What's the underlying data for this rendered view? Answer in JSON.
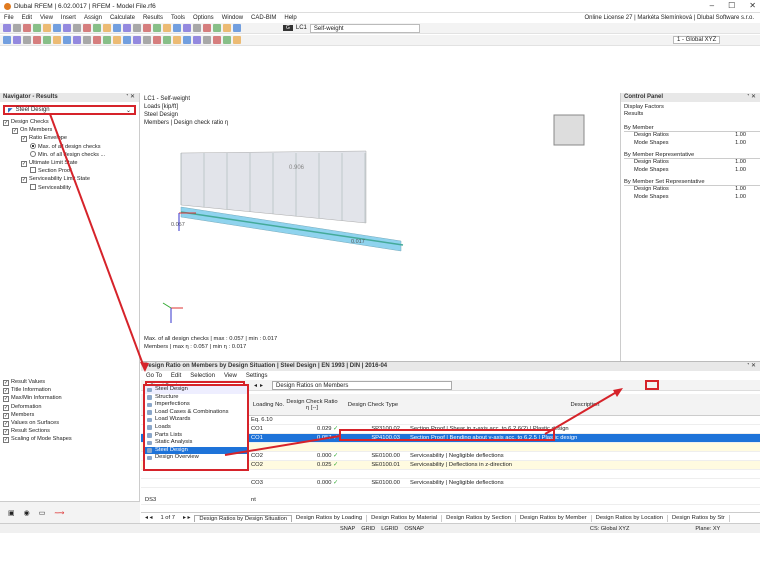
{
  "app": {
    "title": "Dlubal RFEM | 6.02.0017 | RFEM - Model File.rf6",
    "license": "Online License 27 | Markéta Slemínková | Dlubal Software s.r.o."
  },
  "menu": [
    "File",
    "Edit",
    "View",
    "Insert",
    "Assign",
    "Calculate",
    "Results",
    "Tools",
    "Options",
    "Window",
    "CAD-BIM",
    "Help"
  ],
  "loadcase": {
    "tag": "G",
    "id": "LC1",
    "name": "Self-weight",
    "cs": "1 - Global XYZ"
  },
  "navigator": {
    "title": "Navigator - Results",
    "selector": "Steel Design",
    "tree": [
      {
        "indent": 0,
        "type": "chk",
        "checked": true,
        "label": "Design Checks"
      },
      {
        "indent": 1,
        "type": "chk",
        "checked": true,
        "label": "On Members"
      },
      {
        "indent": 2,
        "type": "chk",
        "checked": true,
        "label": "Ratio Envelope"
      },
      {
        "indent": 3,
        "type": "radio",
        "checked": true,
        "label": "Max. of all design checks"
      },
      {
        "indent": 3,
        "type": "radio",
        "checked": false,
        "label": "Min. of all design checks ..."
      },
      {
        "indent": 2,
        "type": "chk",
        "checked": true,
        "label": "Ultimate Limit State"
      },
      {
        "indent": 3,
        "type": "chk",
        "checked": false,
        "label": "Section Proof"
      },
      {
        "indent": 2,
        "type": "chk",
        "checked": true,
        "label": "Serviceability Limit State"
      },
      {
        "indent": 3,
        "type": "chk",
        "checked": false,
        "label": "Serviceability"
      }
    ],
    "lower": [
      "Result Values",
      "Title Information",
      "Max/Min Information",
      "Deformation",
      "Members",
      "Values on Surfaces",
      "Result Sections",
      "Scaling of Mode Shapes"
    ]
  },
  "view": {
    "lines": [
      "LC1 - Self-weight",
      "Loads [kip/ft]",
      "Steel Design",
      "Members | Design check ratio η"
    ],
    "load_value": "0.906",
    "ratio_top": "0.017",
    "ratio_left": "0.057",
    "footer": [
      "Max. of all design checks | max : 0.057 | min : 0.017",
      "Members | max η : 0.057 | min η : 0.017"
    ]
  },
  "control": {
    "title": "Control Panel",
    "sub1": "Display Factors",
    "sub2": "Results",
    "groups": [
      {
        "name": "By Member",
        "items": [
          [
            "Design Ratios",
            "1.00"
          ],
          [
            "Mode Shapes",
            "1.00"
          ]
        ]
      },
      {
        "name": "By Member Representative",
        "items": [
          [
            "Design Ratios",
            "1.00"
          ],
          [
            "Mode Shapes",
            "1.00"
          ]
        ]
      },
      {
        "name": "By Member Set Representative",
        "items": [
          [
            "Design Ratios",
            "1.00"
          ],
          [
            "Mode Shapes",
            "1.00"
          ]
        ]
      }
    ]
  },
  "table": {
    "title": "Design Ratio on Members by Design Situation | Steel Design | EN 1993 | DIN | 2016-04",
    "menu": [
      "Go To",
      "Edit",
      "Selection",
      "View",
      "Settings"
    ],
    "module": "Steel Design",
    "result": "Design Ratios on Members",
    "headers": [
      "Loading No.",
      "Design Check Ratio η [--]",
      "Design Check Type",
      "Description"
    ],
    "rows": [
      {
        "lc": "CO1",
        "ratio": "0.029",
        "type": "SP3100.02",
        "desc": "Section Proof | Shear in z-axis acc. to 6.2.6(2) | Plastic design",
        "style": ""
      },
      {
        "lc": "CO1",
        "ratio": "0.057",
        "type": "SP4100.03",
        "desc": "Section Proof | Bending about y-axis acc. to 6.2.5 | Plastic design",
        "style": "sel"
      },
      {
        "lc": "",
        "ratio": "",
        "type": "",
        "desc": "",
        "style": "yellow"
      },
      {
        "lc": "CO2",
        "ratio": "0.000",
        "type": "SE0100.00",
        "desc": "Serviceability | Negligible deflections",
        "style": ""
      },
      {
        "lc": "CO2",
        "ratio": "0.025",
        "type": "SE0100.01",
        "desc": "Serviceability | Deflections in z-direction",
        "style": "yellow"
      },
      {
        "lc": "",
        "ratio": "",
        "type": "",
        "desc": "",
        "style": ""
      },
      {
        "lc": "CO3",
        "ratio": "0.000",
        "type": "SE0100.00",
        "desc": "Serviceability | Negligible deflections",
        "style": ""
      }
    ],
    "ds3": "DS3",
    "ds3_sub": "nt",
    "ds3_val": "0.00",
    "eq": "Eq. 6.10",
    "dropdown": [
      "Structure",
      "Imperfections",
      "Load Cases & Combinations",
      "Load Wizards",
      "Loads",
      "Static Analysis",
      "Steel Design",
      "Design Overview"
    ],
    "dropdown_extra": "Parts Lists",
    "pager": "1 of 7",
    "tabs": [
      "Design Ratios by Design Situation",
      "Design Ratios by Loading",
      "Design Ratios by Material",
      "Design Ratios by Section",
      "Design Ratios by Member",
      "Design Ratios by Location",
      "Design Ratios by Str"
    ]
  },
  "status": [
    "SNAP",
    "GRID",
    "LGRID",
    "OSNAP",
    "CS: Global XYZ",
    "Plane: XY"
  ]
}
